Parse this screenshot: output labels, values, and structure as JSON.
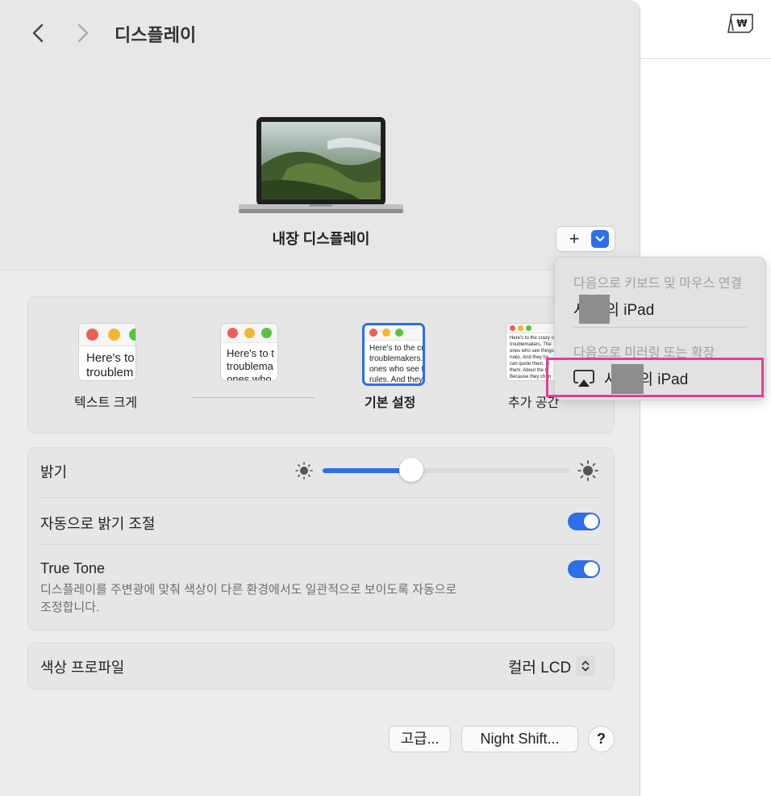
{
  "toolbar": {
    "title": "디스플레이",
    "back_label": "뒤로",
    "forward_label": "앞으로",
    "menubar_icon": "won-input-source-icon"
  },
  "display": {
    "name": "내장 디스플레이",
    "add_label": "+"
  },
  "resolution": {
    "options": [
      {
        "preview": [
          "Here's to",
          "troublem"
        ],
        "label": "텍스트 크게"
      },
      {
        "preview": [
          "Here's to t",
          "troublema",
          "ones who"
        ],
        "label": ""
      },
      {
        "preview": [
          "Here's to the cr",
          "troublemakers.",
          "ones who see t",
          "rules. And they"
        ],
        "label": "기본 설정",
        "selected": true
      },
      {
        "preview": [
          "Here's to the crazy o",
          "troublemakers. The",
          "ones who see things",
          "rules. And they ha",
          "can quote them, di",
          "them. About the o",
          "Because they chan"
        ],
        "label": "추가 공간"
      }
    ]
  },
  "brightness": {
    "label": "밝기",
    "level": 0.36
  },
  "auto_brightness": {
    "label": "자동으로 밝기 조절",
    "on": true
  },
  "true_tone": {
    "label": "True Tone",
    "description_line1": "디스플레이를 주변광에 맞춰 색상이 다른 환경에서도 일관적으로 보이도록 자동으로",
    "description_line2": "조정합니다.",
    "on": true
  },
  "color_profile": {
    "label": "색상 프로파일",
    "value": "컬러 LCD"
  },
  "buttons": {
    "advanced": "고급...",
    "night_shift": "Night Shift...",
    "help": "?"
  },
  "menu": {
    "header1": "다음으로 키보드 및 마우스 연결",
    "item1_prefix": "사",
    "item1_suffix": "의 iPad",
    "header2": "다음으로 미러링 또는 확장",
    "item2_prefix": "사",
    "item2_suffix": "의 iPad",
    "item2_icon": "airplay-icon"
  },
  "colors": {
    "accent": "#2d6ee9",
    "highlight": "#e43d99"
  }
}
